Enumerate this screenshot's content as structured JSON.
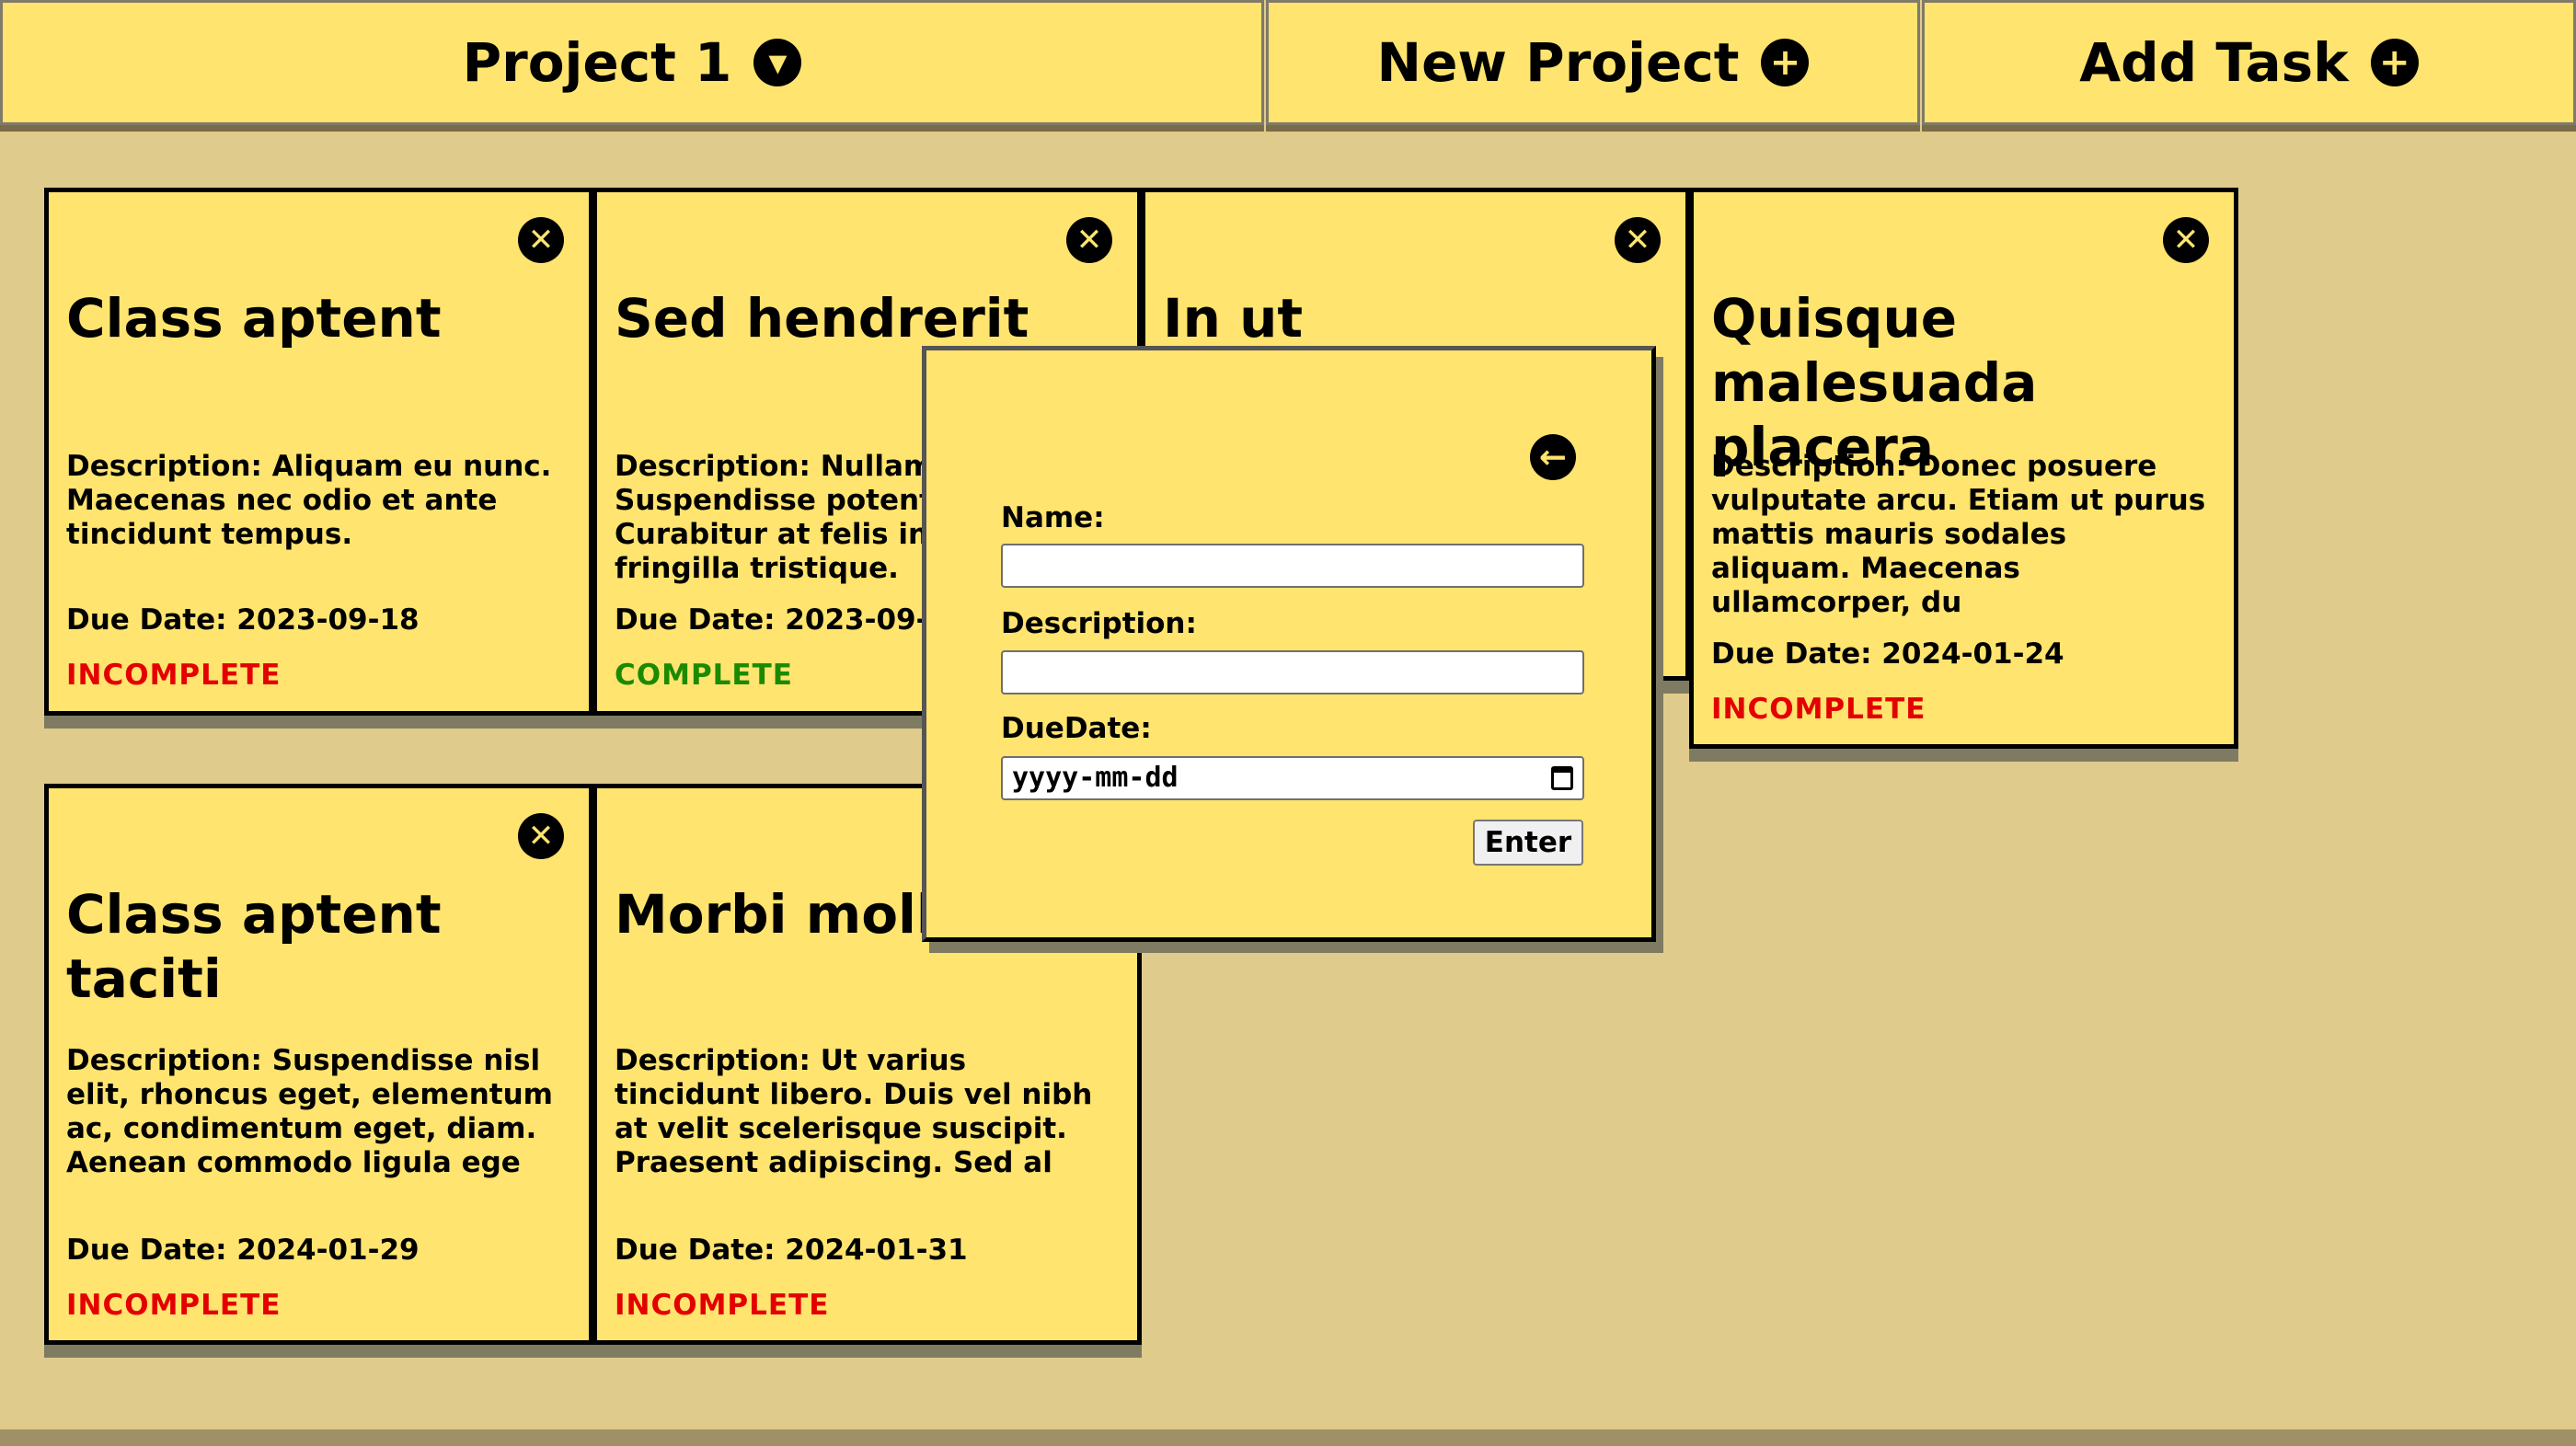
{
  "header": {
    "project_label": "Project 1",
    "new_project_label": "New Project",
    "add_task_label": "Add Task",
    "icons": {
      "project": "chevron-down-icon",
      "new_project": "plus-icon",
      "add_task": "plus-icon"
    }
  },
  "tasks": [
    {
      "title": "Class aptent",
      "description": "Description: Aliquam eu nunc. Maecenas nec odio et ante tincidunt tempus.",
      "due": "Due Date: 2023-09-18",
      "status": "INCOMPLETE"
    },
    {
      "title": "Sed hendrerit",
      "description": "Description: Nullam vel sem. Suspendisse potenti. Curabitur at felis in nunc fringilla tristique.",
      "due": "Due Date: 2023-09-21",
      "status": "COMPLETE"
    },
    {
      "title": "In ut",
      "description": "",
      "due": "",
      "status": ""
    },
    {
      "title": "Quisque malesuada placera",
      "description": "Description: Donec posuere vulputate arcu. Etiam ut purus mattis mauris sodales aliquam. Maecenas ullamcorper, du",
      "due": "Due Date: 2024-01-24",
      "status": "INCOMPLETE"
    },
    {
      "title": "Class aptent taciti",
      "description": "Description: Suspendisse nisl elit, rhoncus eget, elementum ac, condimentum eget, diam. Aenean commodo ligula ege",
      "due": "Due Date: 2024-01-29",
      "status": "INCOMPLETE"
    },
    {
      "title": "Morbi mollis",
      "description": "Description: Ut varius tincidunt libero. Duis vel nibh at velit scelerisque suscipit. Praesent adipiscing. Sed al",
      "due": "Due Date: 2024-01-31",
      "status": "INCOMPLETE"
    }
  ],
  "modal": {
    "name_label": "Name:",
    "name_value": "",
    "description_label": "Description:",
    "description_value": "",
    "due_label": "DueDate:",
    "due_placeholder": "yyyy-mm-dd",
    "enter_label": "Enter"
  },
  "colors": {
    "card": "#ffe46f",
    "background": "#dfcb8c",
    "incomplete": "#e40000",
    "complete": "#1a8a00"
  }
}
